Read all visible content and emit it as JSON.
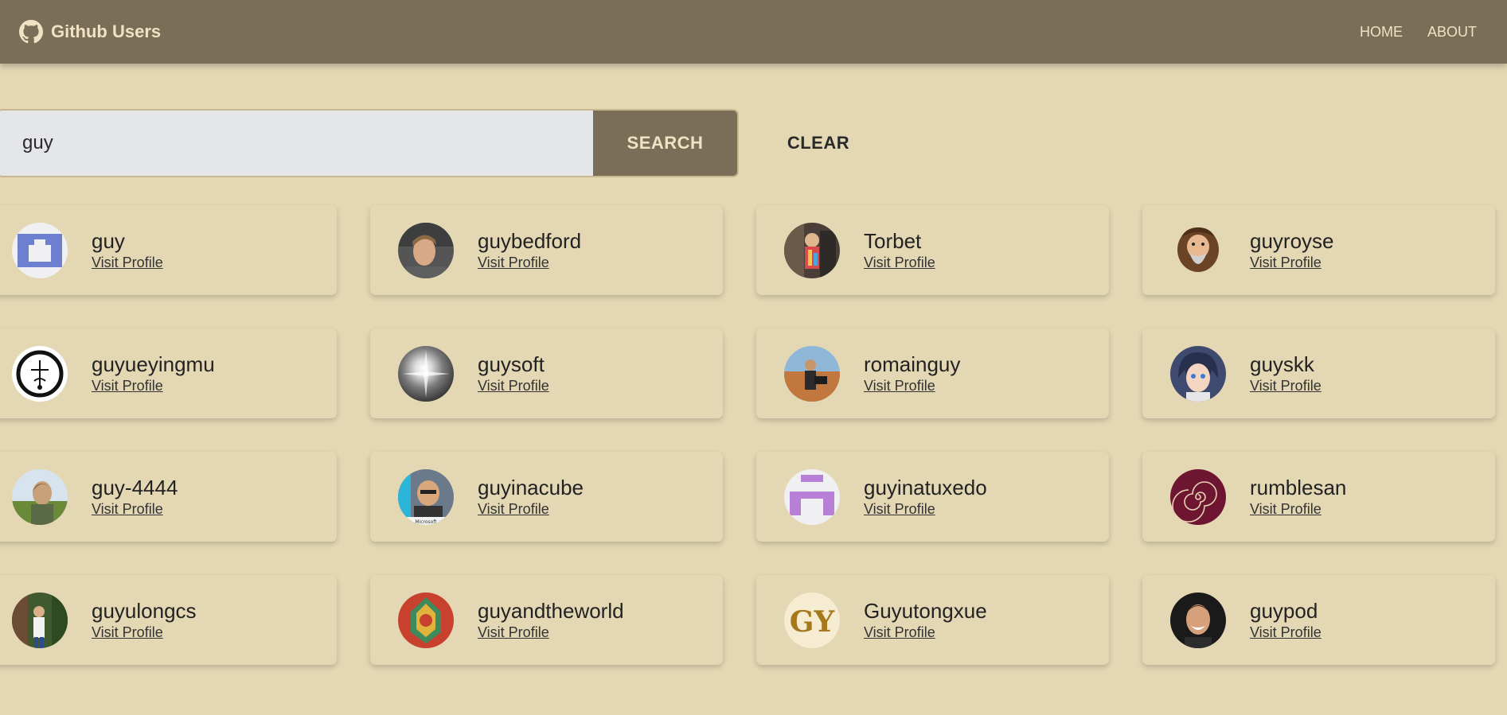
{
  "app": {
    "title": "Github Users",
    "nav": [
      {
        "label": "HOME"
      },
      {
        "label": "ABOUT"
      }
    ]
  },
  "search": {
    "value": "guy",
    "placeholder": "",
    "submit_label": "SEARCH",
    "clear_label": "CLEAR"
  },
  "colors": {
    "navbar": "#7a6e58",
    "background": "#e3d7b4",
    "accent_text": "#efe3c4",
    "input_bg": "#e5e6ea"
  },
  "users": [
    {
      "login": "guy",
      "link_label": "Visit Profile",
      "avatar": "identicon-blue"
    },
    {
      "login": "guybedford",
      "link_label": "Visit Profile",
      "avatar": "photo-portrait"
    },
    {
      "login": "Torbet",
      "link_label": "Visit Profile",
      "avatar": "photo-colorful"
    },
    {
      "login": "guyroyse",
      "link_label": "Visit Profile",
      "avatar": "cartoon-wizard"
    },
    {
      "login": "guyueyingmu",
      "link_label": "Visit Profile",
      "avatar": "ink-circle"
    },
    {
      "login": "guysoft",
      "link_label": "Visit Profile",
      "avatar": "light-flare"
    },
    {
      "login": "romainguy",
      "link_label": "Visit Profile",
      "avatar": "photo-desert"
    },
    {
      "login": "guyskk",
      "link_label": "Visit Profile",
      "avatar": "anime-portrait"
    },
    {
      "login": "guy-4444",
      "link_label": "Visit Profile",
      "avatar": "photo-outdoor"
    },
    {
      "login": "guyinacube",
      "link_label": "Visit Profile",
      "avatar": "cartoon-bald"
    },
    {
      "login": "guyinatuxedo",
      "link_label": "Visit Profile",
      "avatar": "identicon-purple"
    },
    {
      "login": "rumblesan",
      "link_label": "Visit Profile",
      "avatar": "spiral-shell"
    },
    {
      "login": "guyulongcs",
      "link_label": "Visit Profile",
      "avatar": "photo-forest"
    },
    {
      "login": "guyandtheworld",
      "link_label": "Visit Profile",
      "avatar": "ornate-red"
    },
    {
      "login": "Guyutongxue",
      "link_label": "Visit Profile",
      "avatar": "monogram-gy"
    },
    {
      "login": "guypod",
      "link_label": "Visit Profile",
      "avatar": "photo-smile"
    }
  ]
}
